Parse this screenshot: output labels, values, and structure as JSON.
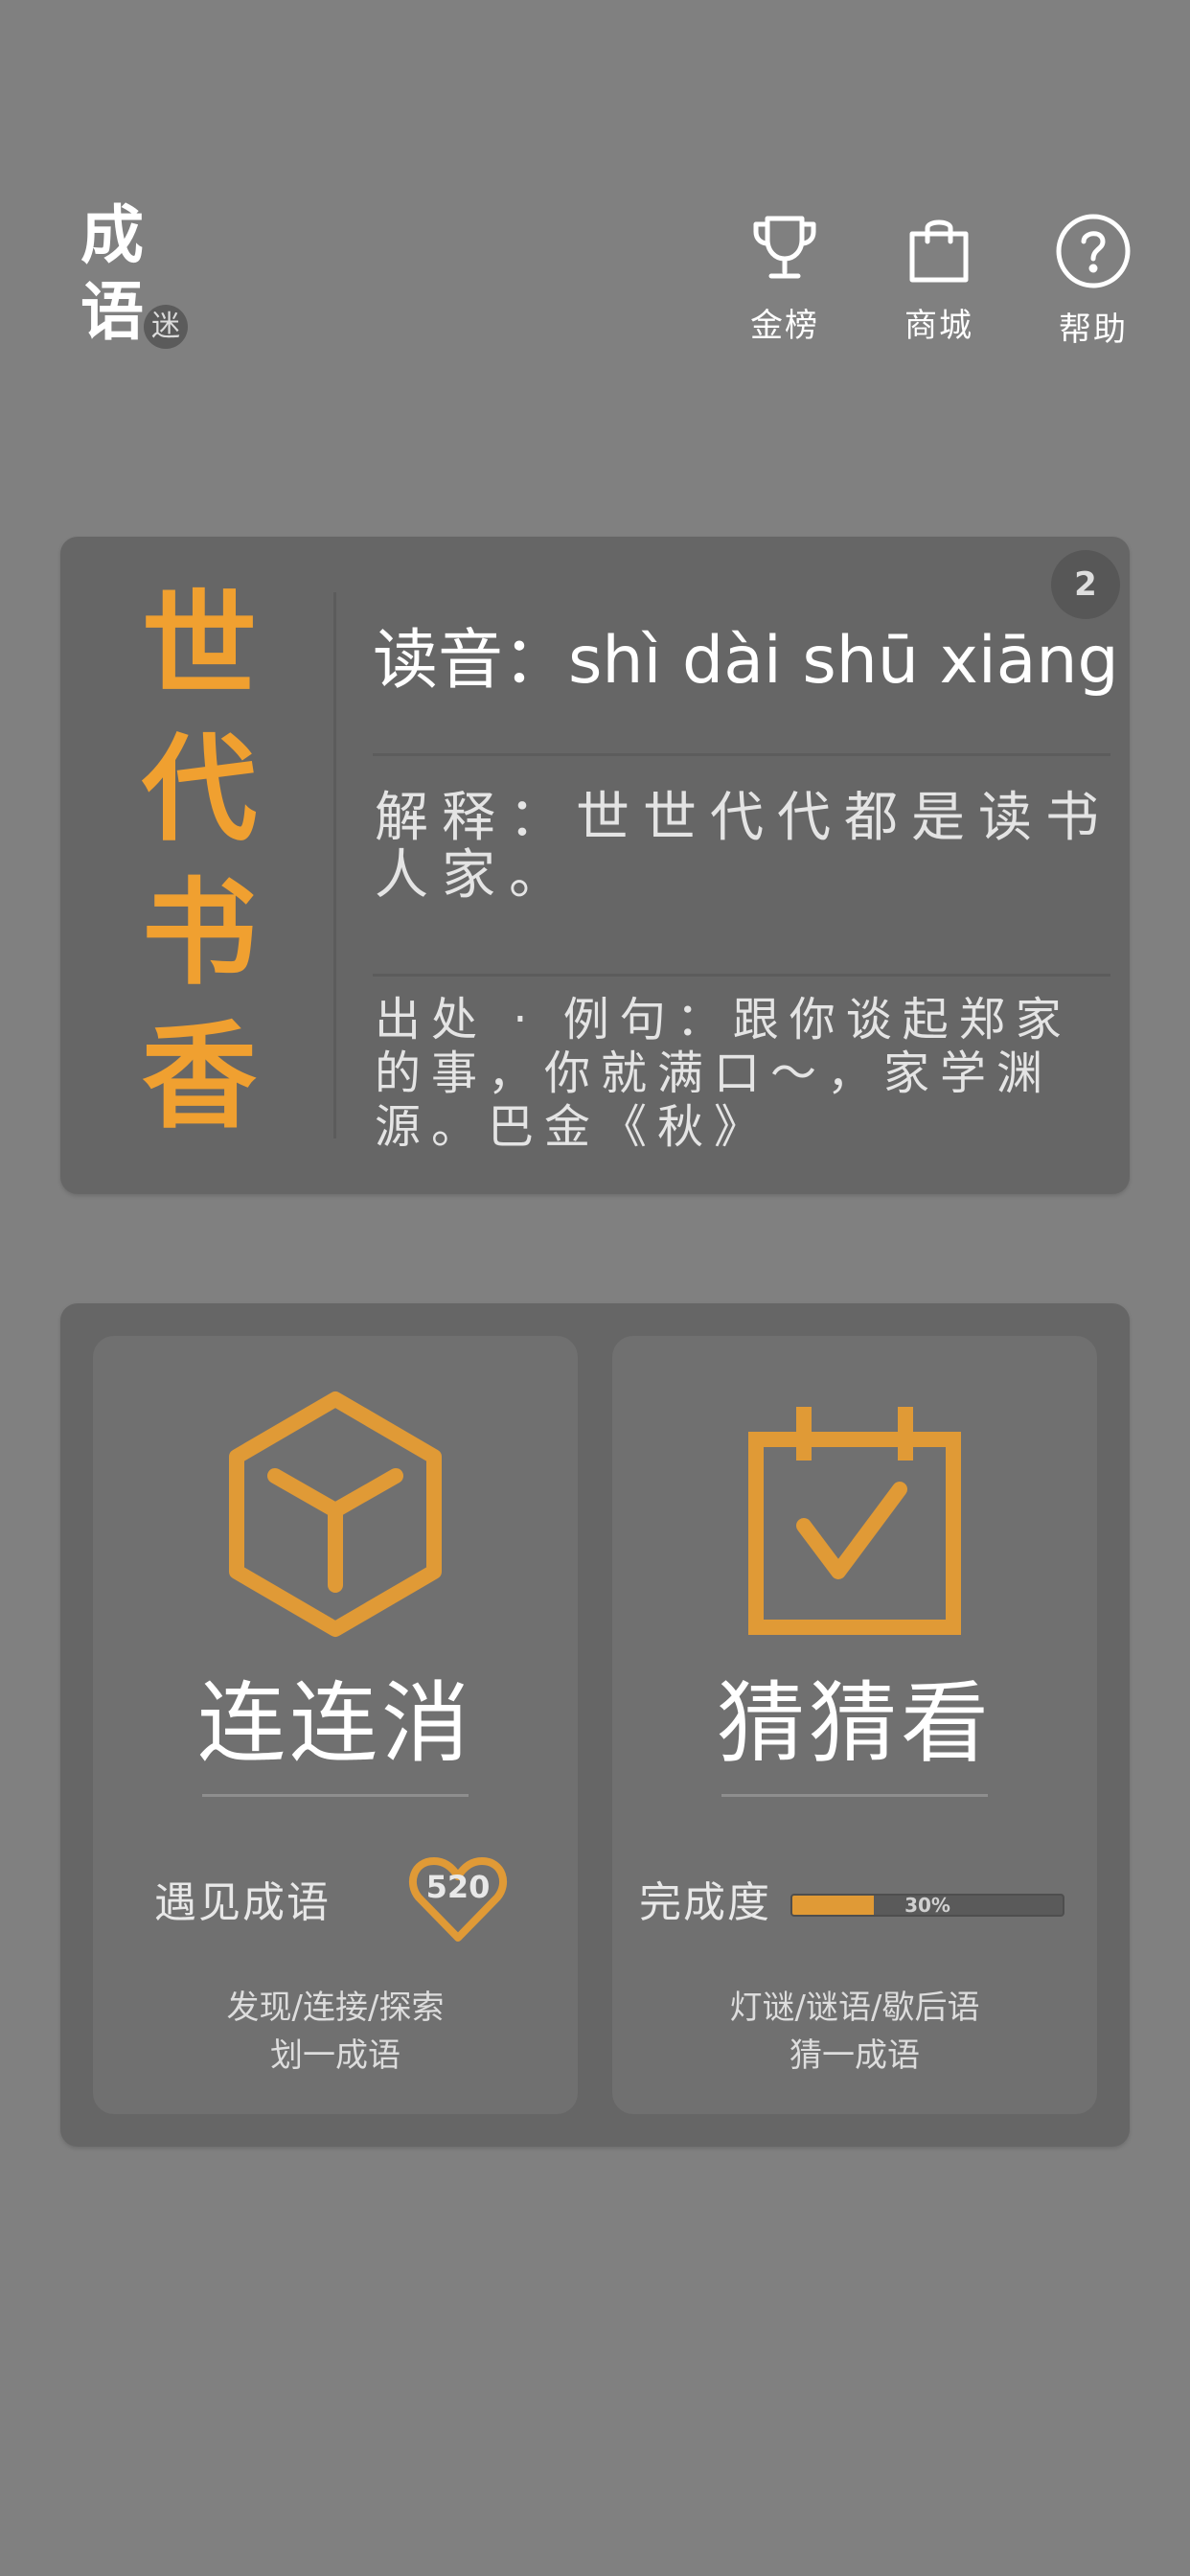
{
  "app": {
    "logo_char_1": "成",
    "logo_char_2": "语",
    "logo_badge": "迷"
  },
  "nav": [
    {
      "label": "金榜",
      "icon": "trophy-icon"
    },
    {
      "label": "商城",
      "icon": "shopping-bag-icon"
    },
    {
      "label": "帮助",
      "icon": "help-circle-icon"
    }
  ],
  "idiom": {
    "index": "2",
    "chars": [
      "世",
      "代",
      "书",
      "香"
    ],
    "pinyin": "读音：shì dài shū xiāng",
    "meaning": "解释：世世代代都是读书人家。",
    "source": "出处 · 例句：跟你谈起郑家的事，你就满口～，家学渊源。巴金《秋》"
  },
  "games": {
    "link": {
      "title": "连连消",
      "meet_label": "遇见成语",
      "count": "520",
      "desc_line1": "发现/连接/探索",
      "desc_line2": "划一成语",
      "icon": "cube-icon"
    },
    "guess": {
      "title": "猜猜看",
      "progress_label": "完成度",
      "progress_value": 0.3,
      "progress_text": "30%",
      "desc_line1": "灯谜/谜语/歇后语",
      "desc_line2": "猜一成语",
      "icon": "calendar-check-icon"
    }
  },
  "colors": {
    "background": "#808080",
    "card": "#666666",
    "accent": "#f0a030"
  }
}
